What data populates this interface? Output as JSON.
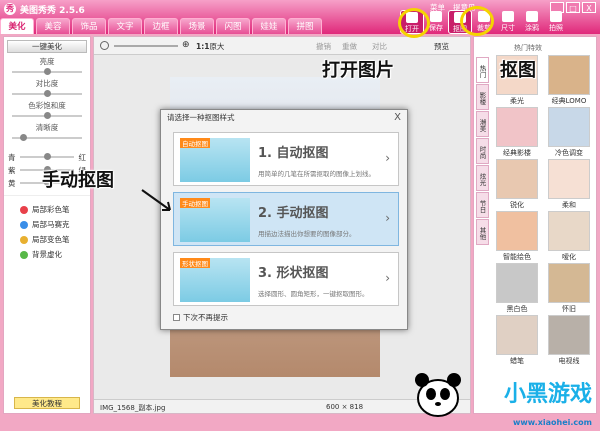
{
  "app": {
    "title": "美图秀秀 2.5.6",
    "logo_glyph": "秀"
  },
  "tabs": [
    "美化",
    "美容",
    "饰品",
    "文字",
    "边框",
    "场景",
    "闪图",
    "娃娃",
    "拼图"
  ],
  "top_links": [
    "菜单",
    "提意见"
  ],
  "window_buttons": [
    "_",
    "□",
    "X"
  ],
  "toolbar": [
    {
      "label": "打开",
      "icon": "folder-icon",
      "highlight": true
    },
    {
      "label": "保存",
      "icon": "save-icon"
    },
    {
      "label": "抠图",
      "icon": "scissors-icon",
      "highlight": true
    },
    {
      "label": "裁剪",
      "icon": "crop-icon"
    },
    {
      "label": "尺寸",
      "icon": "resize-icon"
    },
    {
      "label": "涂鸦",
      "icon": "pen-icon"
    },
    {
      "label": "拍照",
      "icon": "camera-icon"
    }
  ],
  "left_panel": {
    "one_key": "一键美化",
    "sliders": [
      {
        "label": "亮度",
        "level": 0.5
      },
      {
        "label": "对比度",
        "level": 0.5
      },
      {
        "label": "色彩饱和度",
        "level": 0.5
      },
      {
        "label": "清晰度",
        "level": 0.15
      }
    ],
    "color_sliders": [
      {
        "left": "青",
        "right": "红",
        "level": 0.5
      },
      {
        "left": "紫",
        "right": "绿",
        "level": 0.5
      },
      {
        "left": "黄",
        "right": "蓝",
        "level": 0.5
      }
    ],
    "brushes": [
      {
        "label": "局部彩色笔",
        "color": "#e8404a"
      },
      {
        "label": "局部马赛克",
        "color": "#3a8ee8"
      },
      {
        "label": "局部变色笔",
        "color": "#e8b030"
      },
      {
        "label": "背景虚化",
        "color": "#58b848"
      }
    ],
    "tutorial": "美化教程"
  },
  "canvas": {
    "ratio": "1:1",
    "original": "原大",
    "undo": "撤销",
    "redo": "重做",
    "contrast": "对比",
    "preview": "预览",
    "file_name": "IMG_1568_副本.jpg",
    "dimensions": "600 × 818"
  },
  "right_panel": {
    "header": "热门特效",
    "tabs": [
      "热门",
      "影楼",
      "潮美",
      "时尚",
      "炫光",
      "节日",
      "其他"
    ],
    "effects": [
      {
        "label": "柔光",
        "color": "#f4d8c8"
      },
      {
        "label": "经典LOMO",
        "color": "#d9b38a"
      },
      {
        "label": "经典影楼",
        "color": "#f1c4c8"
      },
      {
        "label": "冷色调变",
        "color": "#c8d8e8"
      },
      {
        "label": "锐化",
        "color": "#e8c8b0"
      },
      {
        "label": "柔和",
        "color": "#f6e0d4"
      },
      {
        "label": "智能绘色",
        "color": "#f0c0a0"
      },
      {
        "label": "嗳化",
        "color": "#e8d8c8"
      },
      {
        "label": "黑白色",
        "color": "#c8c8c8"
      },
      {
        "label": "怀旧",
        "color": "#d4b894"
      },
      {
        "label": "蜡笔",
        "color": "#e0d0c4"
      },
      {
        "label": "电视线",
        "color": "#b8b0a8"
      }
    ]
  },
  "dialog": {
    "title": "请选择一种抠图样式",
    "options": [
      {
        "tag": "自动抠图",
        "title": "1. 自动抠图",
        "desc": "用简单的几笔在所需抠取的图像上划线。",
        "selected": false
      },
      {
        "tag": "手动抠图",
        "title": "2. 手动抠图",
        "desc": "用描边法描出你想要的图像部分。",
        "selected": true
      },
      {
        "tag": "形状抠图",
        "title": "3. 形状抠图",
        "desc": "选择圆形、圆角矩形，一键抠取图形。",
        "selected": false
      }
    ],
    "checkbox": "下次不再提示",
    "close": "X"
  },
  "annotations": {
    "open": "打开图片",
    "cutout": "抠图",
    "manual": "手动抠图"
  },
  "watermark": {
    "text": "小黑游戏",
    "url": "www.xiaohei.com"
  },
  "colors": {
    "brand": "#e0287a",
    "highlight": "#f5d400"
  }
}
